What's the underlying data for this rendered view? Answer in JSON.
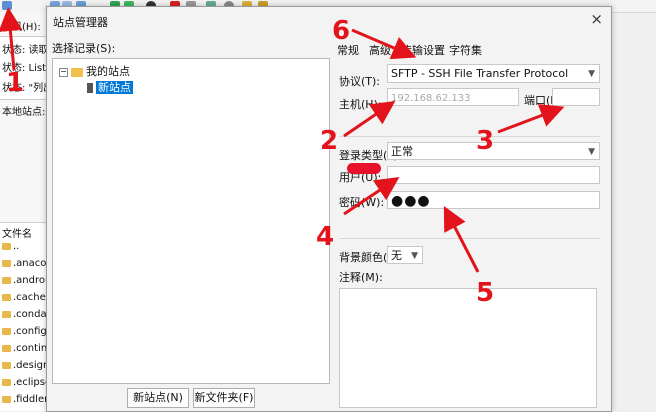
{
  "background_app": {
    "host_label": "主机(H):",
    "status_lines": [
      "状态: 读取目",
      "状态: Listin",
      "状态: \"列出\""
    ],
    "local_site_label": "本地站点:",
    "file_header": "文件名",
    "files": [
      "..",
      ".anacon",
      ".androi",
      ".cache",
      ".conda",
      ".config",
      ".contin",
      ".design",
      ".eclipse",
      ".fiddler"
    ]
  },
  "dialog": {
    "title": "站点管理器",
    "close_glyph": "×",
    "tree_label": "选择记录(S):",
    "tree": {
      "root": "我的站点",
      "child": "新站点"
    },
    "buttons": {
      "new_site": "新站点(N)",
      "new_folder": "新文件夹(F)"
    },
    "tabs": [
      "常规",
      "高级",
      "传输设置",
      "字符集"
    ],
    "form": {
      "protocol_label": "协议(T):",
      "protocol_value": "SFTP - SSH File Transfer Protocol",
      "host_label": "主机(H):",
      "host_value": "192.168.62.133",
      "port_label": "端口(P):",
      "port_value": "",
      "logon_label": "登录类型(L):",
      "logon_value": "正常",
      "user_label": "用户(U):",
      "password_label": "密码(W):",
      "password_value": "●●●",
      "bgcolor_label": "背景颜色(B)",
      "bgcolor_value": "无",
      "notes_label": "注释(M):"
    }
  },
  "annotations": [
    "1",
    "2",
    "3",
    "4",
    "5",
    "6"
  ],
  "colors": {
    "annotation": "#e3131b",
    "selection": "#0078d7",
    "folder": "#f0c04a"
  }
}
